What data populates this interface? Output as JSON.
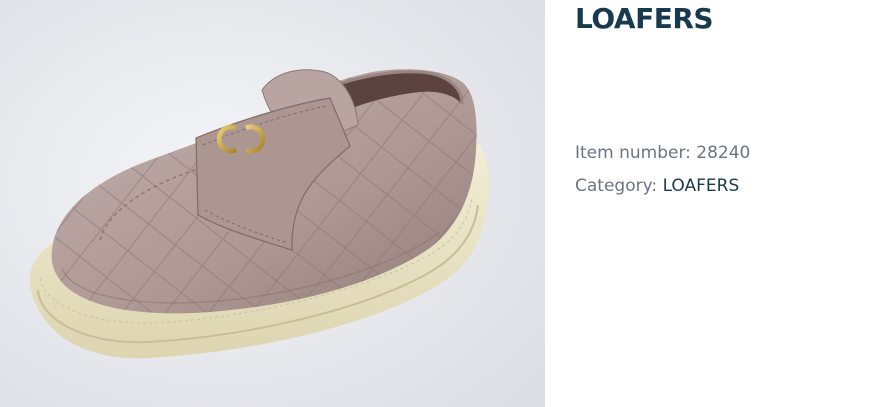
{
  "product": {
    "title": "LOAFERS",
    "item_number_label": "Item number: ",
    "item_number": "28240",
    "category_label": "Category: ",
    "category": "LOAFERS"
  },
  "image": {
    "subject": "quilted-loafer-shoe",
    "colors": {
      "background": "#e9eaee",
      "leather": "#b39f9b",
      "leather_shade": "#8f7b78",
      "sole": "#eae4c6",
      "logo": "#c9a34a"
    }
  },
  "colors": {
    "title": "#183a4f",
    "meta_text": "#6b7585",
    "link": "#183a4f"
  }
}
